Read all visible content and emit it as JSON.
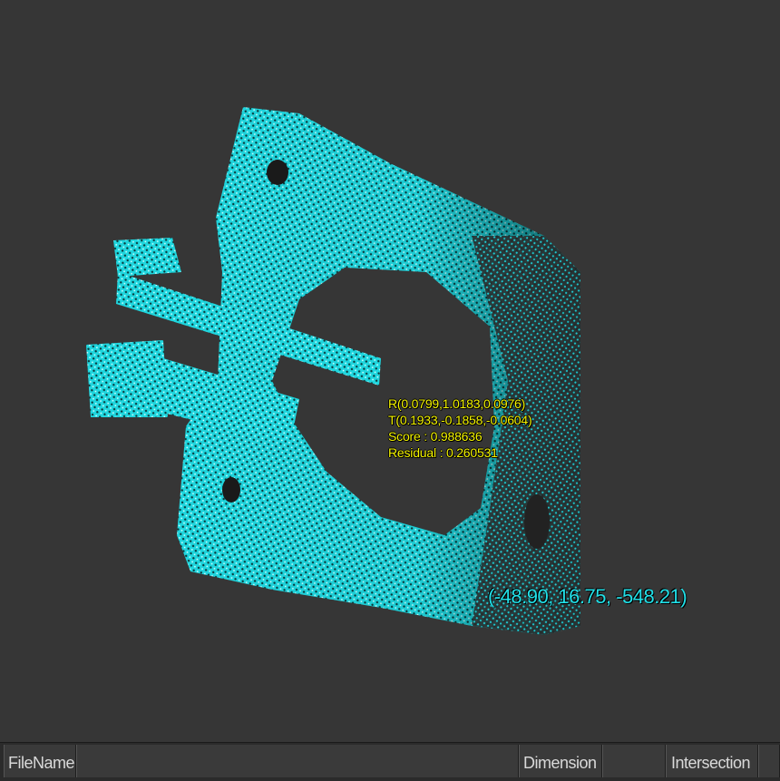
{
  "overlay": {
    "rotation": "R(0.0799,1.0183,0.0976)",
    "translation": "T(0.1933,-0.1858,-0.0604)",
    "score": "Score : 0.988636",
    "residual": "Residual : 0.260531"
  },
  "cursor_coord": "(-48.90, 16.75, -548.21)",
  "statusbar": {
    "filename_label": "FileName",
    "dimension_label": "Dimension",
    "intersection_label": "Intersection"
  },
  "colors": {
    "background": "#363636",
    "point_cloud": "#22e6ef",
    "overlay_text": "#f5f500",
    "coord_text": "#22e0e8"
  }
}
